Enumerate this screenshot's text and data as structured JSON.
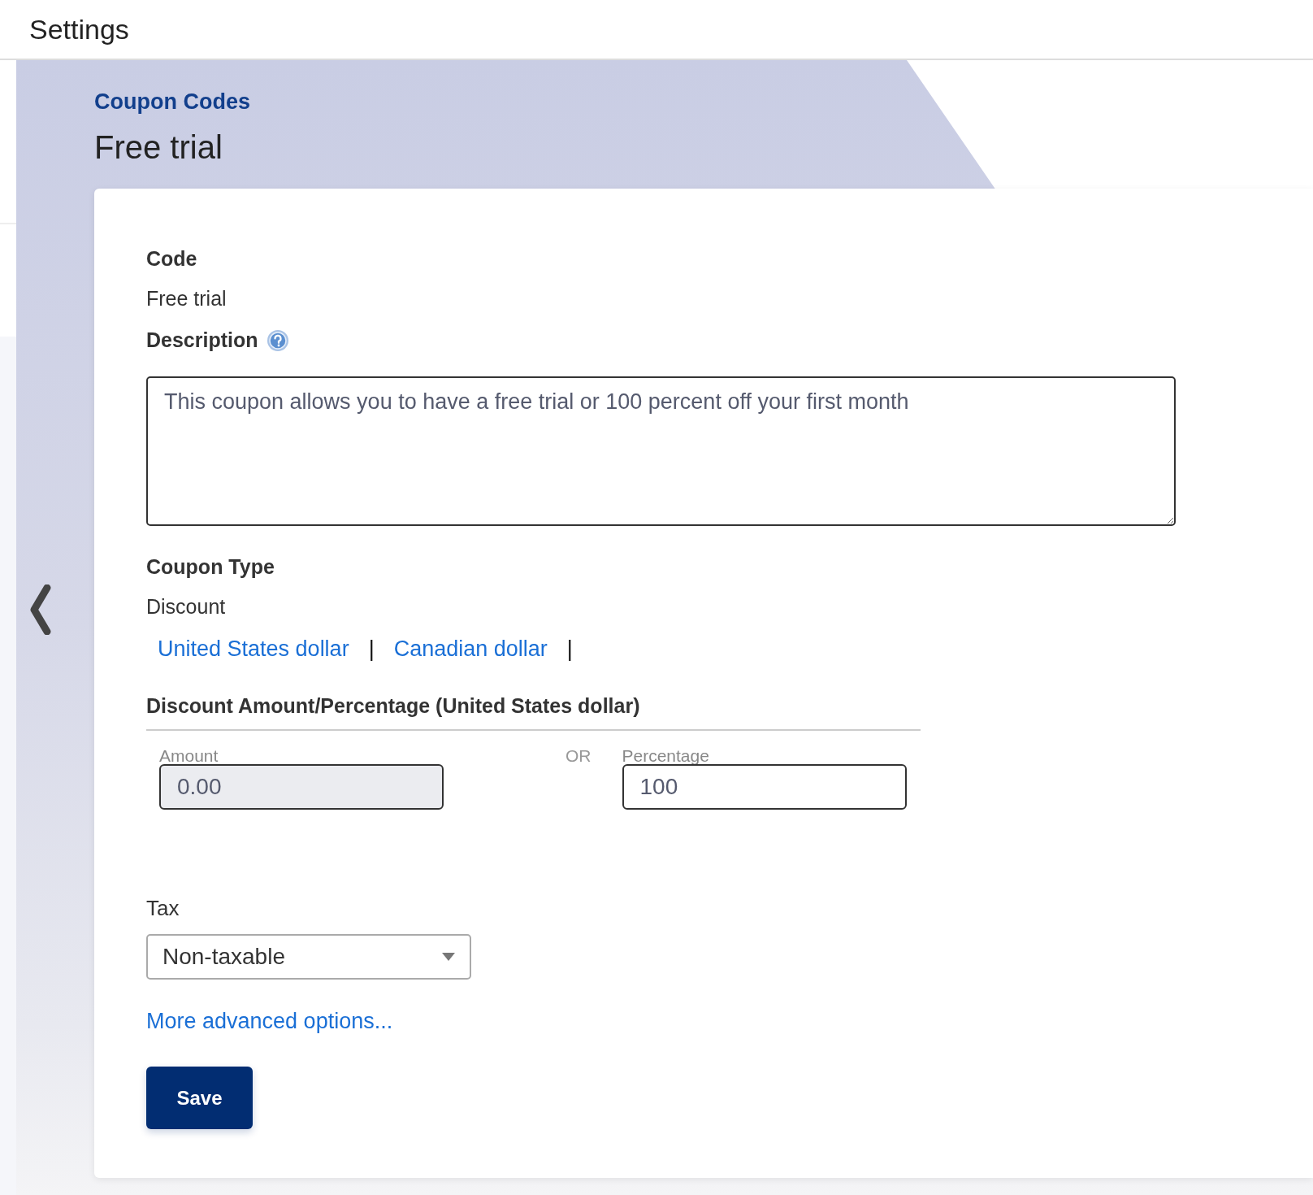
{
  "header": {
    "title": "Settings"
  },
  "breadcrumb": "Coupon Codes",
  "page_title": "Free trial",
  "form": {
    "code": {
      "label": "Code",
      "value": "Free trial"
    },
    "description": {
      "label": "Description",
      "value": "This coupon allows you to have a free trial or 100 percent off your first month"
    },
    "coupon_type": {
      "label": "Coupon Type",
      "value": "Discount"
    },
    "currencies": [
      {
        "kind": "link",
        "text": "United States dollar"
      },
      {
        "kind": "separator",
        "text": "|"
      },
      {
        "kind": "link",
        "text": "Canadian dollar"
      },
      {
        "kind": "separator",
        "text": "|"
      }
    ],
    "discount": {
      "heading": "Discount Amount/Percentage (United States dollar)",
      "or_label": "OR",
      "fields": [
        {
          "label": "Amount",
          "value": "0.00",
          "disabled": true
        },
        {
          "label": "Percentage",
          "value": "100",
          "disabled": false
        }
      ]
    },
    "tax": {
      "label": "Tax",
      "value": "Non-taxable"
    },
    "advanced_link": "More advanced options...",
    "save_button": "Save"
  }
}
